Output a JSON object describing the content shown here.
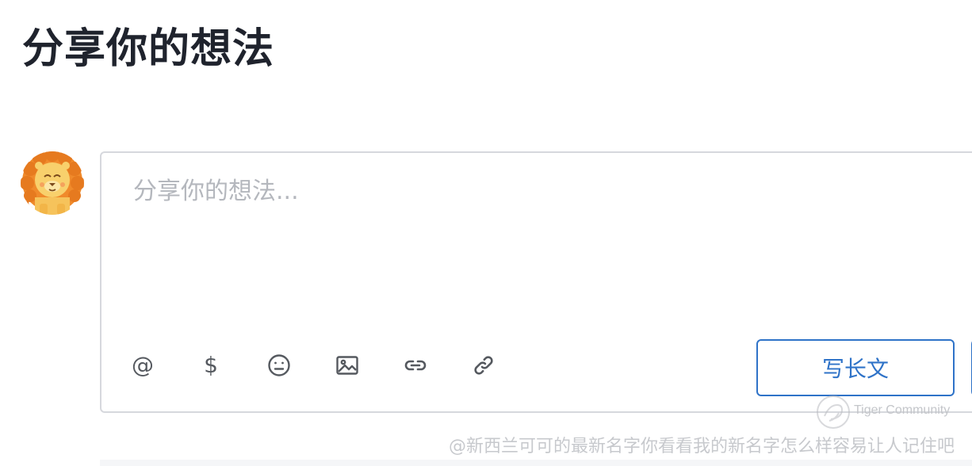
{
  "header": {
    "title": "分享你的想法"
  },
  "composer": {
    "placeholder": "分享你的想法...",
    "value": ""
  },
  "toolbar": {
    "mention_label": "@",
    "mention_icon": "at-icon",
    "stock_label": "$",
    "stock_icon": "dollar-icon",
    "emoji_icon": "emoji-icon",
    "image_icon": "image-icon",
    "link_icon": "link-icon",
    "attach_icon": "chain-link-icon",
    "long_post_label": "写长文"
  },
  "watermark": {
    "brand": "Tiger Community",
    "author": "@新西兰可可的最新名字你看看我的新名字怎么样容易让人记住吧"
  },
  "colors": {
    "accent": "#2f73c8",
    "border": "#d6d8dd",
    "placeholder": "#b4b7bd",
    "icon": "#55595f",
    "title": "#1f232d"
  }
}
